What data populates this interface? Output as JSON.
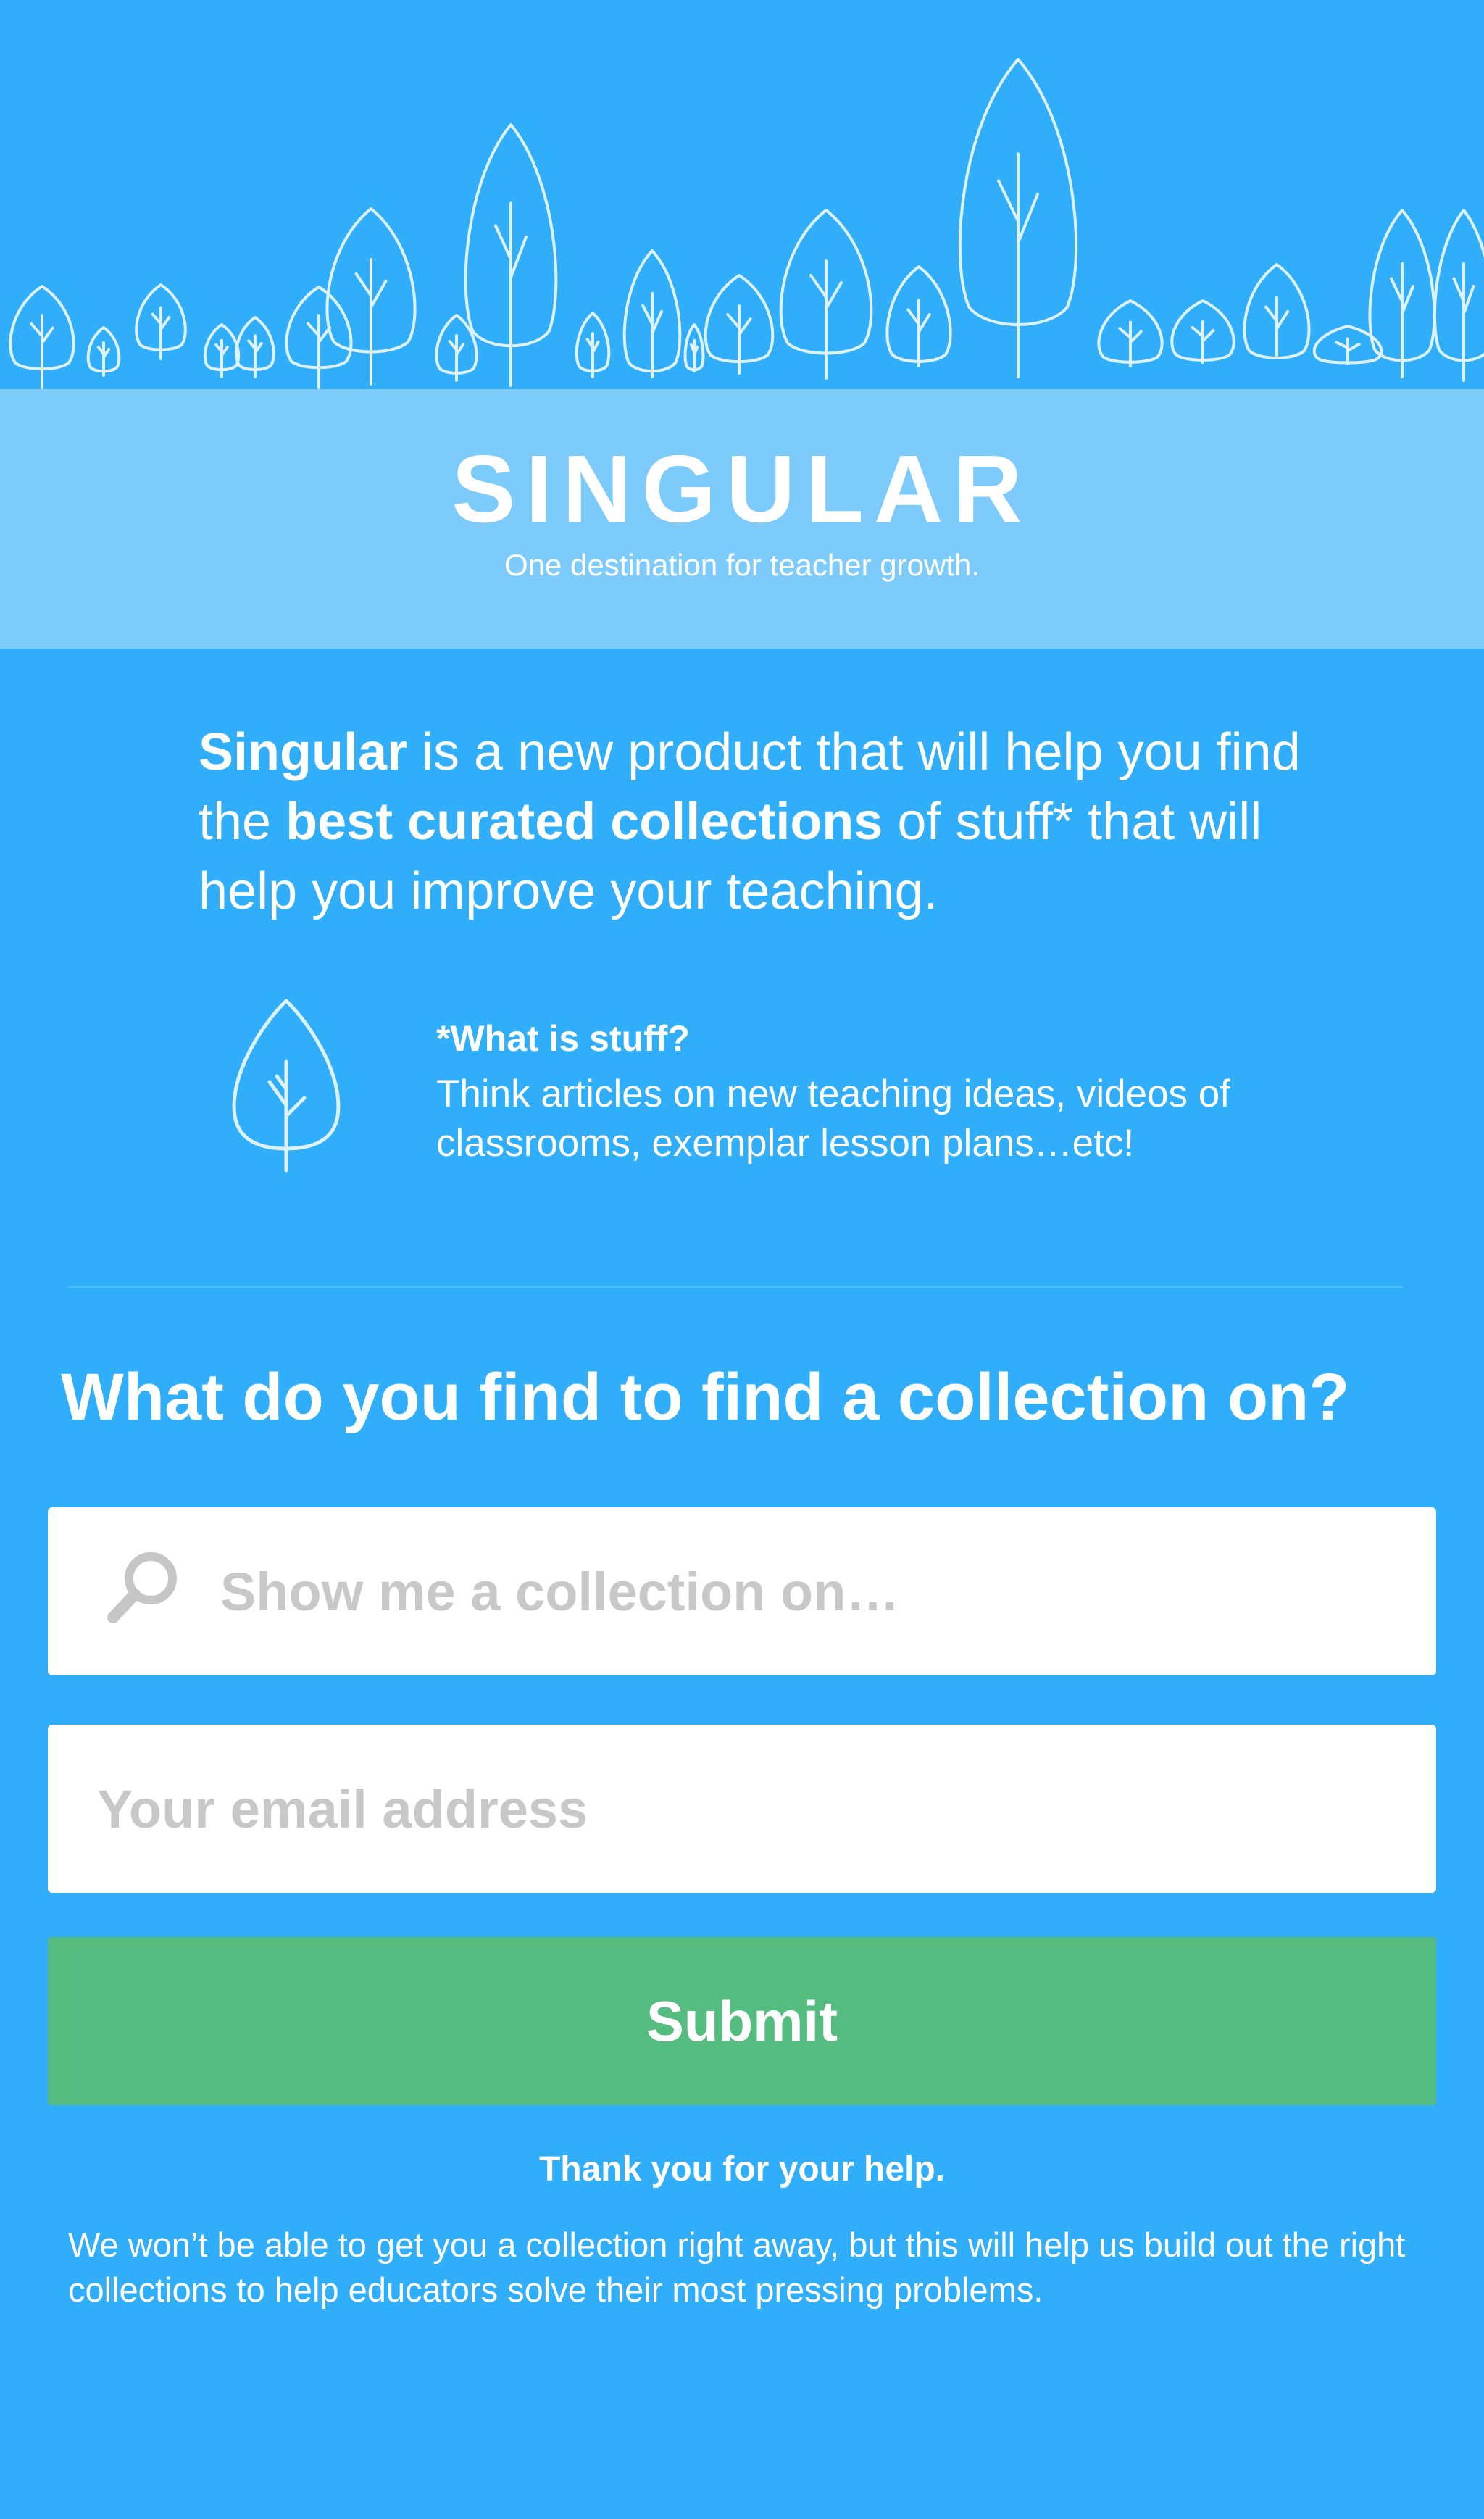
{
  "brand": {
    "title": "SINGULAR",
    "tagline": "One destination for teacher growth."
  },
  "intro": {
    "part1_bold": "Singular",
    "part2": " is a new product that will help you find the ",
    "part3_bold": "best curated collections",
    "part4": " of stuff* that will help you improve your teaching."
  },
  "note": {
    "title": "*What is stuff?",
    "body": "Think articles on new teaching ideas, videos of classrooms, exemplar lesson plans…etc!"
  },
  "form": {
    "question": "What do you find to find a collection on?",
    "search_placeholder": "Show me a collection on…",
    "email_placeholder": "Your email address",
    "submit_label": "Submit"
  },
  "footer": {
    "thanks": "Thank you for your help.",
    "note": "We won’t be able to get you a collection right away, but this will help us build out the right collections to help educators solve their most pressing problems."
  },
  "icons": {
    "header": "tree-forest-illustration",
    "note": "tree-icon",
    "search": "search-icon"
  },
  "colors": {
    "background": "#30AEF9",
    "brand_band": "#7DCBFA",
    "submit": "#55BC7F",
    "placeholder": "#C8C8C8"
  }
}
